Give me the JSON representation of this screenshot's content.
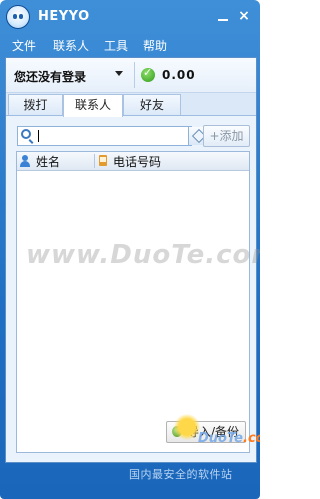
{
  "app": {
    "title": "HEYYO",
    "minimize_label": "",
    "close_label": "×"
  },
  "menu": {
    "items": [
      "文件",
      "联系人",
      "工具",
      "帮助"
    ]
  },
  "status": {
    "login_text": "您还没有登录",
    "balance": "0.00"
  },
  "tabs": [
    {
      "label": "拨打",
      "active": false
    },
    {
      "label": "联系人",
      "active": true
    },
    {
      "label": "好友",
      "active": false
    }
  ],
  "search": {
    "value": "",
    "placeholder": ""
  },
  "add_button": "+添加",
  "list": {
    "columns": [
      "姓名",
      "电话号码"
    ],
    "rows": []
  },
  "watermark": "www.DuoTe.com",
  "import_button": "导入/备份",
  "footer": {
    "brand_main": "DuoTe",
    "brand_accent": ".com",
    "tagline": "国内最安全的软件站"
  },
  "colors": {
    "window_blue": "#1f6fc4",
    "panel_bg": "#eaf2fb",
    "success_green": "#2e9a1a"
  }
}
